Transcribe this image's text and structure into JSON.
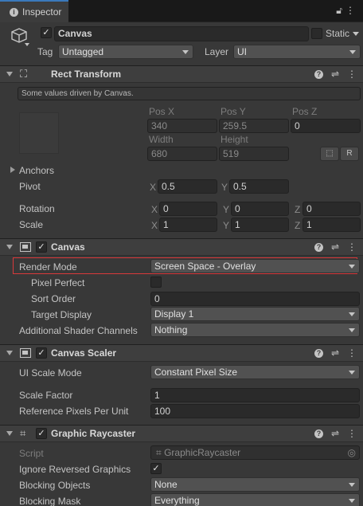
{
  "window": {
    "tab_title": "Inspector",
    "lock_icon": "lock-icon",
    "menu_icon": "kebab-menu-icon"
  },
  "object": {
    "name": "Canvas",
    "static_label": "Static",
    "tag_label": "Tag",
    "tag_value": "Untagged",
    "layer_label": "Layer",
    "layer_value": "UI"
  },
  "rect_transform": {
    "title": "Rect Transform",
    "info": "Some values driven by Canvas.",
    "pos_x_label": "Pos X",
    "pos_y_label": "Pos Y",
    "pos_z_label": "Pos Z",
    "pos_x": "340",
    "pos_y": "259.5",
    "pos_z": "0",
    "width_label": "Width",
    "height_label": "Height",
    "width": "680",
    "height": "519",
    "r_button": "R",
    "anchors_label": "Anchors",
    "pivot_label": "Pivot",
    "pivot_x": "0.5",
    "pivot_y": "0.5",
    "rotation_label": "Rotation",
    "rot_x": "0",
    "rot_y": "0",
    "rot_z": "0",
    "scale_label": "Scale",
    "scale_x": "1",
    "scale_y": "1",
    "scale_z": "1",
    "x": "X",
    "y": "Y",
    "z": "Z"
  },
  "canvas": {
    "title": "Canvas",
    "render_mode_label": "Render Mode",
    "render_mode": "Screen Space - Overlay",
    "pixel_perfect_label": "Pixel Perfect",
    "sort_order_label": "Sort Order",
    "sort_order": "0",
    "target_display_label": "Target Display",
    "target_display": "Display 1",
    "shader_channels_label": "Additional Shader Channels",
    "shader_channels": "Nothing"
  },
  "canvas_scaler": {
    "title": "Canvas Scaler",
    "ui_scale_mode_label": "UI Scale Mode",
    "ui_scale_mode": "Constant Pixel Size",
    "scale_factor_label": "Scale Factor",
    "scale_factor": "1",
    "ref_ppu_label": "Reference Pixels Per Unit",
    "ref_ppu": "100"
  },
  "graphic_raycaster": {
    "title": "Graphic Raycaster",
    "script_label": "Script",
    "script_value": "GraphicRaycaster",
    "ignore_reversed_label": "Ignore Reversed Graphics",
    "blocking_objects_label": "Blocking Objects",
    "blocking_objects": "None",
    "blocking_mask_label": "Blocking Mask",
    "blocking_mask": "Everything"
  },
  "colors": {
    "background": "#383838",
    "header": "#3e3e3e",
    "accent_tab": "#3a79bb",
    "highlight_border": "#d9393b"
  }
}
